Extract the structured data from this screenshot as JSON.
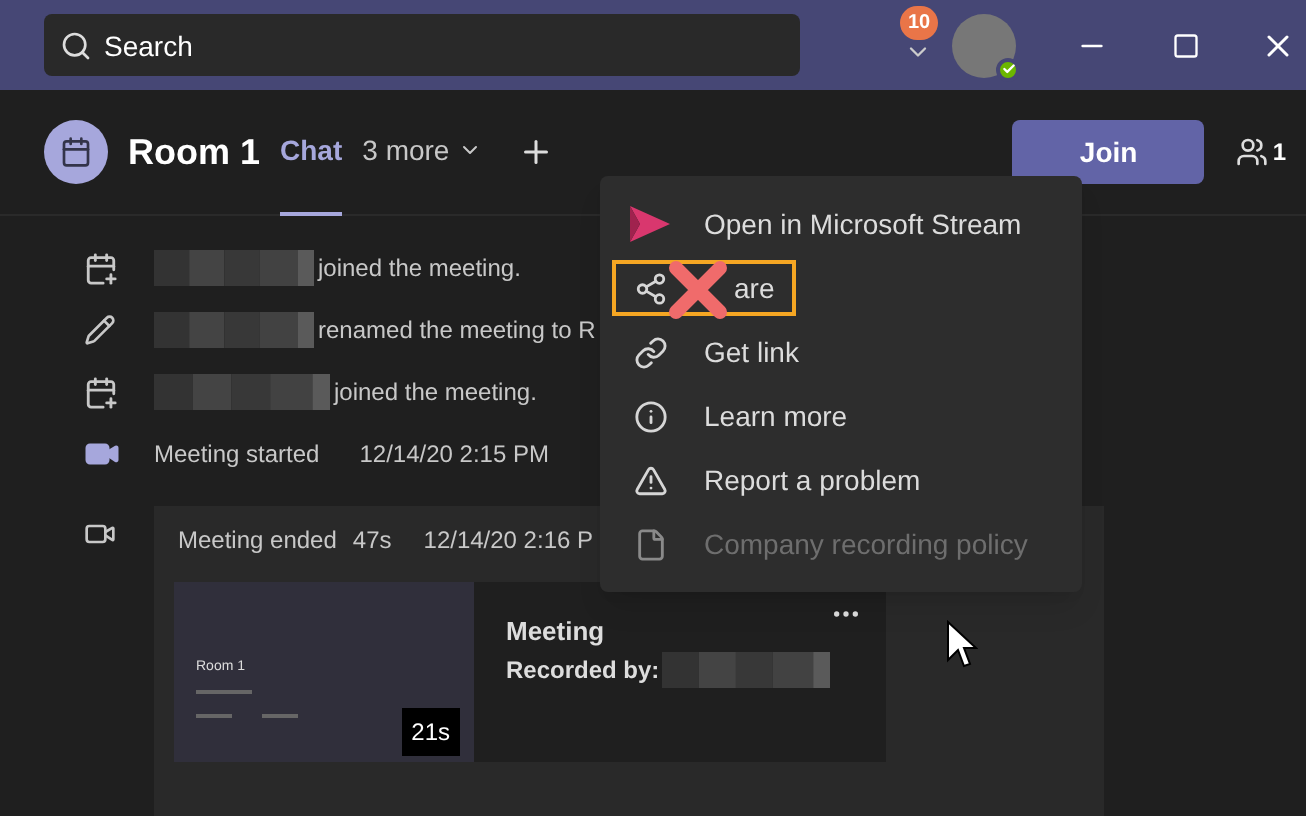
{
  "title_bar": {
    "search": {
      "placeholder": "Search"
    },
    "notification_count": "10"
  },
  "header": {
    "title": "Room 1",
    "tabs": [
      {
        "label": "Chat",
        "selected": true
      },
      {
        "label": "3 more",
        "selected": false
      }
    ],
    "join_button": "Join",
    "participants": "1"
  },
  "activity": [
    {
      "kind": "joined",
      "text": "joined the meeting."
    },
    {
      "kind": "renamed",
      "text": "renamed the meeting to R"
    },
    {
      "kind": "joined",
      "text": "joined the meeting."
    },
    {
      "kind": "started",
      "text": "Meeting started",
      "time": "12/14/20 2:15 PM"
    }
  ],
  "meeting_ended": {
    "label": "Meeting ended",
    "duration": "47s",
    "time": "12/14/20 2:16 P",
    "recording": {
      "thumbnail_title": "Room 1",
      "length": "21s",
      "title": "Meeting",
      "recorded_by": "Recorded by:"
    }
  },
  "context_menu": [
    {
      "kind": "stream",
      "label": "Open in Microsoft Stream",
      "disabled": false,
      "highlighted": false
    },
    {
      "kind": "share",
      "label": "are",
      "disabled": false,
      "highlighted": true
    },
    {
      "kind": "link",
      "label": "Get link",
      "disabled": false,
      "highlighted": false
    },
    {
      "kind": "info",
      "label": "Learn more",
      "disabled": false,
      "highlighted": false
    },
    {
      "kind": "warning",
      "label": "Report a problem",
      "disabled": false,
      "highlighted": false
    },
    {
      "kind": "document",
      "label": "Company recording policy",
      "disabled": true,
      "highlighted": false
    }
  ]
}
